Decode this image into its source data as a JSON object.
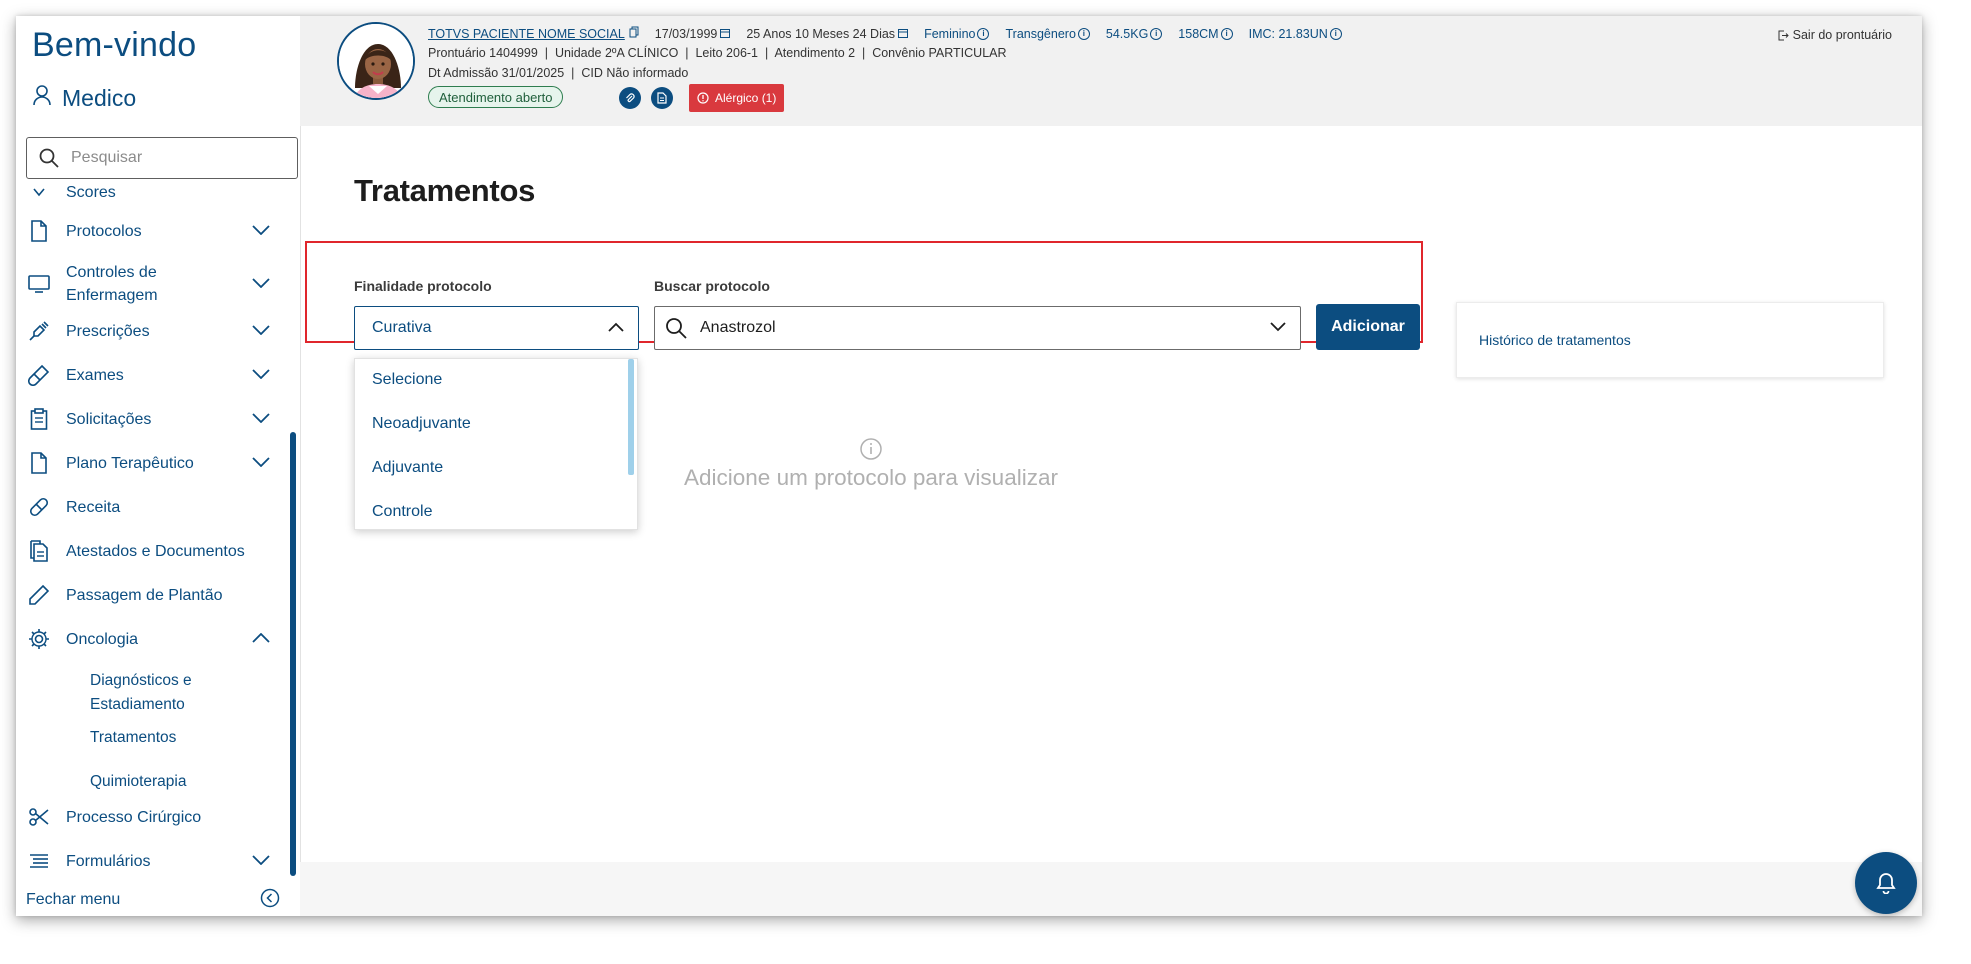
{
  "sidebar": {
    "welcome": "Bem-vindo",
    "role": "Medico",
    "search_placeholder": "Pesquisar",
    "items": [
      {
        "label": "Scores"
      },
      {
        "label": "Protocolos"
      },
      {
        "label": "Controles de Enfermagem"
      },
      {
        "label": "Prescrições"
      },
      {
        "label": "Exames"
      },
      {
        "label": "Solicitações"
      },
      {
        "label": "Plano Terapêutico"
      },
      {
        "label": "Receita"
      },
      {
        "label": "Atestados e Documentos"
      },
      {
        "label": "Passagem de Plantão"
      },
      {
        "label": "Oncologia"
      },
      {
        "label": "Processo Cirúrgico"
      },
      {
        "label": "Formulários"
      }
    ],
    "oncologia_sub": [
      "Diagnósticos e Estadiamento",
      "Tratamentos",
      "Quimioterapia"
    ],
    "close_menu": "Fechar menu"
  },
  "patient": {
    "name": "TOTVS PACIENTE NOME SOCIAL",
    "birth": "17/03/1999",
    "age": "25 Anos 10 Meses 24 Dias",
    "sex": "Feminino",
    "gender": "Transgênero",
    "weight": "54.5KG",
    "height": "158CM",
    "bmi": "IMC: 21.83UN",
    "line2": "Prontuário 1404999  |  Unidade 2ºA CLÍNICO  |  Leito 206-1  |  Atendimento 2  |  Convênio PARTICULAR",
    "line3": "Dt Admissão 31/01/2025  |  CID Não informado",
    "status_badge": "Atendimento aberto",
    "allergy": "Alérgico (1)",
    "logout": "Sair do prontuário"
  },
  "main": {
    "title": "Tratamentos",
    "finalidade_label": "Finalidade protocolo",
    "finalidade_value": "Curativa",
    "finalidade_options": [
      "Selecione",
      "Neoadjuvante",
      "Adjuvante",
      "Controle"
    ],
    "buscar_label": "Buscar protocolo",
    "buscar_value": "Anastrozol",
    "add_button": "Adicionar",
    "history_link": "Histórico de tratamentos",
    "empty_message": "Adicione um protocolo para visualizar"
  },
  "colors": {
    "brand": "#0c4d80",
    "allergy": "#d9393e",
    "highlight": "#e0262c",
    "status": "#2e7d4f"
  }
}
